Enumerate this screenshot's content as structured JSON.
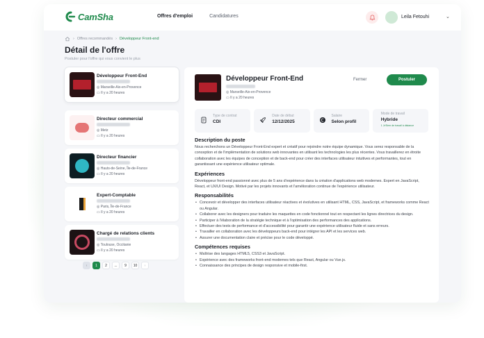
{
  "header": {
    "brand": "CamSha",
    "nav": [
      "Offres d'emploi",
      "Candidatures"
    ],
    "user_name": "Leila Fetouhi"
  },
  "breadcrumb": {
    "items": [
      "Offres recommandés",
      "Développeur Front-end"
    ]
  },
  "page": {
    "title": "Détail de l'offre",
    "subtitle": "Postuler pour l'offre qui vous convient le plus"
  },
  "jobs": [
    {
      "title": "Développeur Front-End",
      "location": "Marseille-Aix-en-Provence",
      "posted": "Il y a 20 heures"
    },
    {
      "title": "Directeur commercial",
      "location": "Metz",
      "posted": "Il y a 20 heures"
    },
    {
      "title": "Directeur financier",
      "location": "Hauts-de-Seine, Île-de-France",
      "posted": "Il y a 20 heures"
    },
    {
      "title": "Expert-Comptable",
      "location": "Paris, Île-de-France",
      "posted": "Il y a 20 heures"
    },
    {
      "title": "Chargé de relations clients",
      "location": "Toulouse, Occitanie",
      "posted": "Il y a 20 heures"
    }
  ],
  "pagination": {
    "pages": [
      "1",
      "2",
      "...",
      "9",
      "10"
    ],
    "current": "1",
    "prev": "‹",
    "next": "›"
  },
  "detail": {
    "title": "Développeur Front-End",
    "location": "Marseille-Aix-en-Provence",
    "posted": "Il y a 20 heures",
    "close_label": "Fermer",
    "apply_label": "Postuler",
    "info": [
      {
        "label": "Type de contrat",
        "value": "CDI"
      },
      {
        "label": "Date de début",
        "value": "12/12/2025"
      },
      {
        "label": "Salaire",
        "value": "Selon profil"
      },
      {
        "label": "Mode de travail",
        "value": "Hybride",
        "note": "1 Jr/Sem de travail à distance"
      }
    ],
    "sections": {
      "description": {
        "heading": "Description du poste",
        "text": "Nous recherchons un Développeur Front-End expert et créatif pour rejoindre notre équipe dynamique. Vous serez responsable de la conception et de l'implémentation de solutions web innovantes en utilisant les technologies les plus récentes. Vous travaillerez en étroite collaboration avec les équipes de conception et de back-end pour créer des interfaces utilisateur intuitives et performantes, tout en garantissant une expérience utilisateur optimale."
      },
      "experience": {
        "heading": "Expériences",
        "text": "Développeur front-end passionné avec plus de 5 ans d'expérience dans la création d'applications web modernes. Expert en JavaScript, React, et UX/UI Design. Motivé par les projets innovants et l'amélioration continue de l'expérience utilisateur."
      },
      "responsibilities": {
        "heading": "Responsabilités",
        "items": [
          "Concevoir et développer des interfaces utilisateur réactives et évolutives en utilisant HTML, CSS, JavaScript, et frameworks comme React ou Angular.",
          "Collaborer avec les designers pour traduire les maquettes en code fonctionnel tout en respectant les lignes directrices du design.",
          "Participer à l'élaboration de la stratégie technique et à l'optimisation des performances des applications.",
          "Effectuer des tests de performance et d'accessibilité pour garantir une expérience utilisateur fluide et sans erreurs.",
          "Travailler en collaboration avec les développeurs back-end pour intégrer les API et les services web.",
          "Assurer une documentation claire et précise pour le code développé."
        ]
      },
      "skills": {
        "heading": "Compétences requises",
        "items": [
          "Maîtrise des langages HTML5, CSS3 et JavaScript.",
          "Expérience avec des frameworks front-end modernes tels que React, Angular ou Vue.js.",
          "Connaissance des principes de design responsive et mobile-first."
        ]
      }
    }
  },
  "colors": {
    "brand_green": "#1f8a4c",
    "background": "#f5f6f9",
    "notification_bg": "#fdecec"
  },
  "icons": [
    "home-icon",
    "bell-icon",
    "location-pin-icon",
    "calendar-icon",
    "contract-icon",
    "rocket-icon",
    "coin-icon",
    "chevron-down-icon"
  ]
}
